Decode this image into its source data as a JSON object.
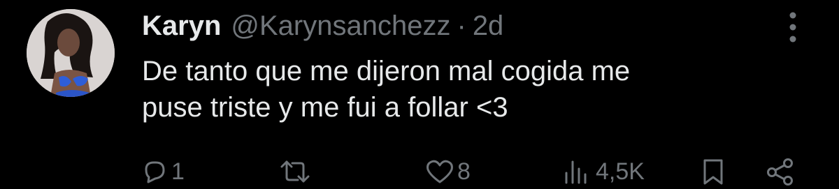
{
  "tweet": {
    "author_name": "Karyn",
    "handle": "@Karynsanchezz",
    "separator": "·",
    "time": "2d",
    "text": "De tanto que me dijeron mal cogida me\npuse triste y me fui a follar <3",
    "avatar_icon": "user-avatar-photo"
  },
  "actions": {
    "reply_count": "1",
    "retweet_count": "",
    "like_count": "8",
    "views_count": "4,5K",
    "icons": [
      "reply-icon",
      "retweet-icon",
      "like-icon",
      "views-icon",
      "bookmark-icon",
      "share-icon"
    ]
  },
  "colors": {
    "background": "#000000",
    "text_primary": "#e7e9ea",
    "text_secondary": "#71767b"
  }
}
